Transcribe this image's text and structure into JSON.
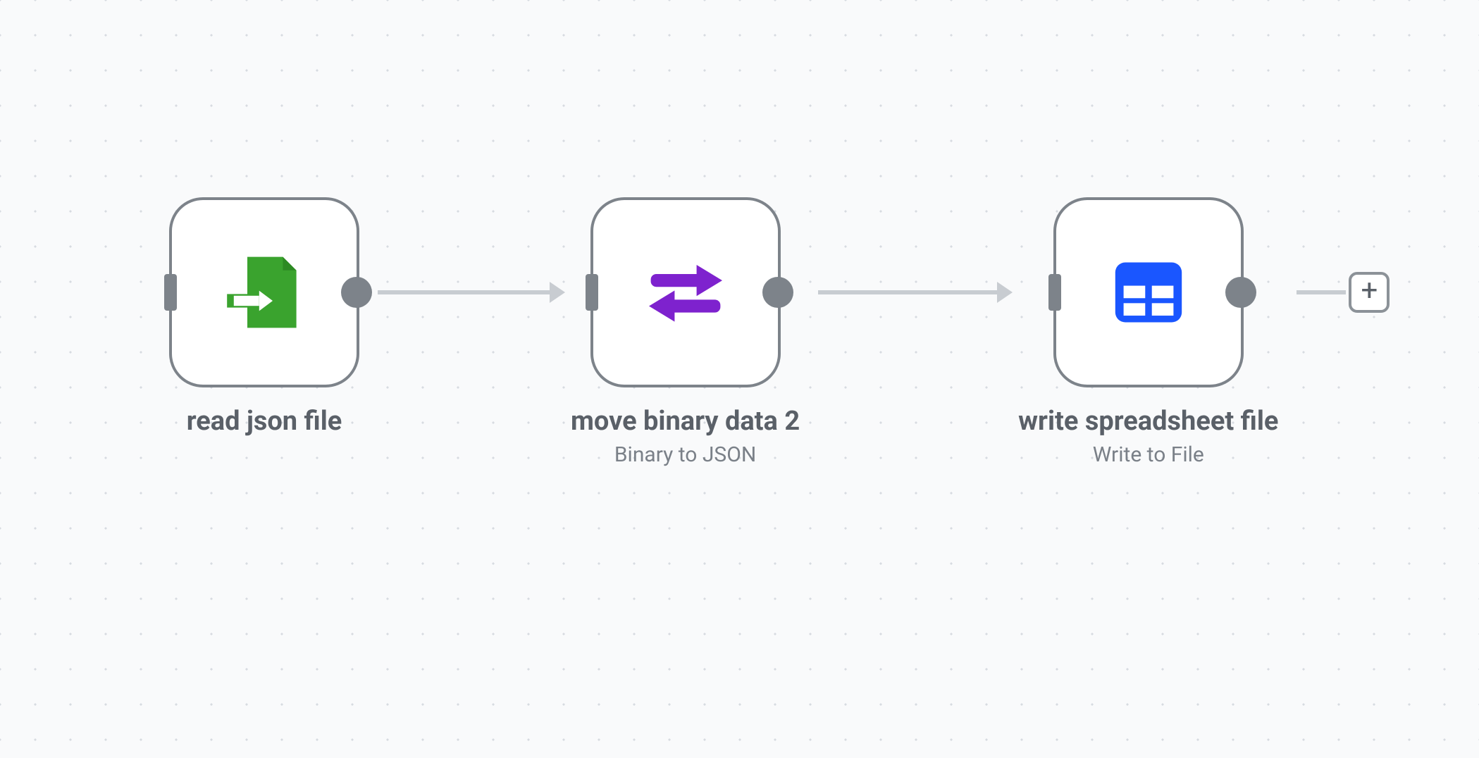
{
  "nodes": [
    {
      "id": "read-json-file",
      "title": "read json file",
      "subtitle": "",
      "icon": "file-import",
      "icon_color": "#3aa32e"
    },
    {
      "id": "move-binary-data-2",
      "title": "move binary data 2",
      "subtitle": "Binary to JSON",
      "icon": "swap-arrows",
      "icon_color": "#7e22ce"
    },
    {
      "id": "write-spreadsheet-file",
      "title": "write spreadsheet file",
      "subtitle": "Write to File",
      "icon": "spreadsheet",
      "icon_color": "#1a56ff"
    }
  ],
  "add_button": {
    "label": "+"
  },
  "colors": {
    "node_border": "#7d838a",
    "connector": "#c8ccd1",
    "text_primary": "#5a6068",
    "text_secondary": "#7a8088",
    "canvas_bg": "#f9fafb"
  }
}
